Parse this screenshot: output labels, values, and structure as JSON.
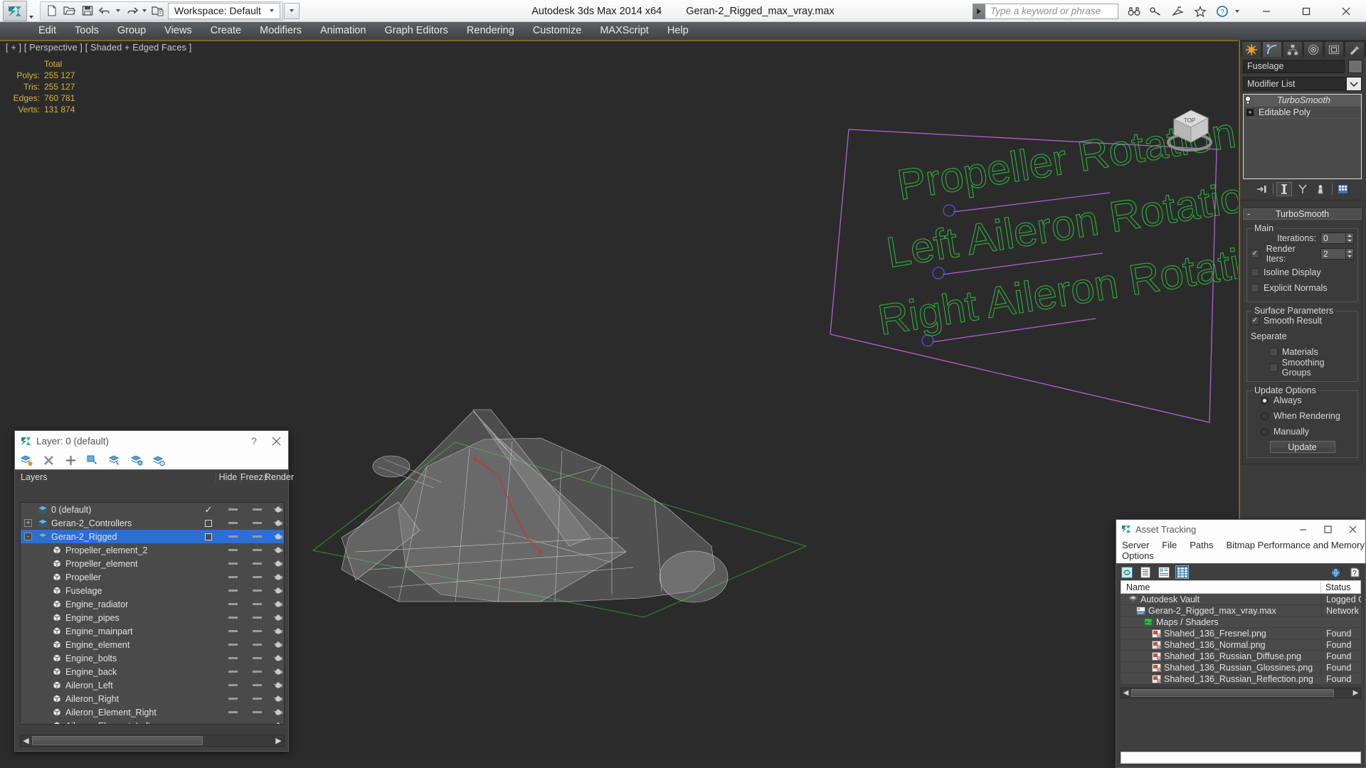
{
  "titlebar": {
    "app_name": "Autodesk 3ds Max  2014 x64",
    "file_name": "Geran-2_Rigged_max_vray.max",
    "workspace_label": "Workspace: Default",
    "search_placeholder": "Type a keyword or phrase",
    "quick_access": [
      "new-icon",
      "open-icon",
      "save-icon",
      "undo-icon",
      "redo-icon",
      "set-project-icon"
    ],
    "window_buttons": [
      "minimize",
      "maximize",
      "close"
    ],
    "help_icons": [
      "binoculars-icon",
      "key-icon",
      "satellite-icon",
      "star-icon",
      "help-icon"
    ]
  },
  "menubar": {
    "items": [
      "Edit",
      "Tools",
      "Group",
      "Views",
      "Create",
      "Modifiers",
      "Animation",
      "Graph Editors",
      "Rendering",
      "Customize",
      "MAXScript",
      "Help"
    ]
  },
  "viewport": {
    "label": "[ + ] [ Perspective ] [ Shaded + Edged Faces ]",
    "stats": {
      "header": "Total",
      "rows": [
        {
          "label": "Polys:",
          "value": "255 127"
        },
        {
          "label": "Tris:",
          "value": "255 127"
        },
        {
          "label": "Edges:",
          "value": "760 781"
        },
        {
          "label": "Verts:",
          "value": "131 874"
        }
      ]
    },
    "annotations": [
      "Propeller Rotation",
      "Left Aileron Rotation",
      "Right Aileron Rotation"
    ],
    "annotation_color": "#2fb03c",
    "helper_color": "#b45fd6",
    "grid_color": "#2f7a34"
  },
  "command_panel": {
    "tabs": [
      "create-tab",
      "modify-tab",
      "hierarchy-tab",
      "motion-tab",
      "display-tab",
      "utilities-tab"
    ],
    "active_tab": "modify-tab",
    "object_name": "Fuselage",
    "modifier_list_label": "Modifier List",
    "stack": [
      {
        "name": "TurboSmooth",
        "selected": true
      },
      {
        "name": "Editable Poly",
        "selected": false
      }
    ],
    "stack_buttons": [
      "pin-stack-icon",
      "show-end-result-icon",
      "make-unique-icon",
      "remove-modifier-icon",
      "configure-sets-icon"
    ],
    "rollout": {
      "title": "TurboSmooth",
      "collapse_glyph": "-",
      "groups": [
        {
          "name": "Main",
          "fields": [
            {
              "label": "Iterations:",
              "value": "0",
              "type": "spinner"
            },
            {
              "label": "Render Iters:",
              "value": "2",
              "type": "spinner",
              "checkbox": true,
              "checked": true
            }
          ],
          "checkboxes": [
            {
              "label": "Isoline Display",
              "checked": false
            },
            {
              "label": "Explicit Normals",
              "checked": false
            }
          ]
        },
        {
          "name": "Surface Parameters",
          "checkboxes": [
            {
              "label": "Smooth Result",
              "checked": true
            }
          ],
          "subgroup_label": "Separate",
          "sub_checkboxes": [
            {
              "label": "Materials",
              "checked": false
            },
            {
              "label": "Smoothing Groups",
              "checked": false
            }
          ]
        },
        {
          "name": "Update Options",
          "radios": [
            {
              "label": "Always",
              "selected": true
            },
            {
              "label": "When Rendering",
              "selected": false
            },
            {
              "label": "Manually",
              "selected": false
            }
          ],
          "button": "Update"
        }
      ]
    }
  },
  "layer_dialog": {
    "title": "Layer: 0 (default)",
    "help_glyph": "?",
    "close_glyph": "✕",
    "toolbar_icons": [
      "create-new-layer-icon",
      "delete-layer-icon",
      "add-selection-icon",
      "select-objects-icon",
      "select-highlighted-icon",
      "highlight-selected-icon",
      "layer-properties-icon"
    ],
    "columns": [
      "Layers",
      "",
      "Hide",
      "Freeze",
      "Render"
    ],
    "rows": [
      {
        "name": "0 (default)",
        "indent": 1,
        "icon": "layer-icon",
        "expander": "",
        "hide": "check",
        "freeze": "dash",
        "render_col": "dash",
        "render": "teapot",
        "selected": false
      },
      {
        "name": "Geran-2_Controllers",
        "indent": 1,
        "icon": "layer-icon",
        "expander": "+",
        "hide": "square",
        "freeze": "dash",
        "render_col": "dash",
        "render": "teapot",
        "selected": false
      },
      {
        "name": "Geran-2_Rigged",
        "indent": 1,
        "icon": "layer-icon",
        "expander": "-",
        "hide": "square",
        "freeze": "dash",
        "render_col": "dash",
        "render": "teapot",
        "selected": true
      },
      {
        "name": "Propeller_element_2",
        "indent": 2,
        "icon": "object-icon",
        "expander": "",
        "hide": "",
        "freeze": "dash",
        "render_col": "dash",
        "render": "teapot",
        "selected": false
      },
      {
        "name": "Propeller_element",
        "indent": 2,
        "icon": "object-icon",
        "expander": "",
        "hide": "",
        "freeze": "dash",
        "render_col": "dash",
        "render": "teapot",
        "selected": false
      },
      {
        "name": "Propeller",
        "indent": 2,
        "icon": "object-icon",
        "expander": "",
        "hide": "",
        "freeze": "dash",
        "render_col": "dash",
        "render": "teapot",
        "selected": false
      },
      {
        "name": "Fuselage",
        "indent": 2,
        "icon": "object-icon",
        "expander": "",
        "hide": "",
        "freeze": "dash",
        "render_col": "dash",
        "render": "teapot",
        "selected": false
      },
      {
        "name": "Engine_radiator",
        "indent": 2,
        "icon": "object-icon",
        "expander": "",
        "hide": "",
        "freeze": "dash",
        "render_col": "dash",
        "render": "teapot",
        "selected": false
      },
      {
        "name": "Engine_pipes",
        "indent": 2,
        "icon": "object-icon",
        "expander": "",
        "hide": "",
        "freeze": "dash",
        "render_col": "dash",
        "render": "teapot",
        "selected": false
      },
      {
        "name": "Engine_mainpart",
        "indent": 2,
        "icon": "object-icon",
        "expander": "",
        "hide": "",
        "freeze": "dash",
        "render_col": "dash",
        "render": "teapot",
        "selected": false
      },
      {
        "name": "Engine_element",
        "indent": 2,
        "icon": "object-icon",
        "expander": "",
        "hide": "",
        "freeze": "dash",
        "render_col": "dash",
        "render": "teapot",
        "selected": false
      },
      {
        "name": "Engine_bolts",
        "indent": 2,
        "icon": "object-icon",
        "expander": "",
        "hide": "",
        "freeze": "dash",
        "render_col": "dash",
        "render": "teapot",
        "selected": false
      },
      {
        "name": "Engine_back",
        "indent": 2,
        "icon": "object-icon",
        "expander": "",
        "hide": "",
        "freeze": "dash",
        "render_col": "dash",
        "render": "teapot",
        "selected": false
      },
      {
        "name": "Aileron_Left",
        "indent": 2,
        "icon": "object-icon",
        "expander": "",
        "hide": "",
        "freeze": "dash",
        "render_col": "dash",
        "render": "teapot",
        "selected": false
      },
      {
        "name": "Aileron_Right",
        "indent": 2,
        "icon": "object-icon",
        "expander": "",
        "hide": "",
        "freeze": "dash",
        "render_col": "dash",
        "render": "teapot",
        "selected": false
      },
      {
        "name": "Aileron_Element_Right",
        "indent": 2,
        "icon": "object-icon",
        "expander": "",
        "hide": "",
        "freeze": "dash",
        "render_col": "dash",
        "render": "teapot",
        "selected": false
      },
      {
        "name": "Aileron_Element_Left",
        "indent": 2,
        "icon": "object-icon",
        "expander": "",
        "hide": "",
        "freeze": "dash",
        "render_col": "dash",
        "render": "teapot",
        "selected": false
      }
    ]
  },
  "asset_tracking": {
    "title": "Asset Tracking",
    "menu": [
      "Server",
      "File",
      "Paths",
      "Bitmap Performance and Memory",
      "Options"
    ],
    "toolbar_icons": [
      "refresh-icon",
      "list-view-icon",
      "details-view-icon",
      "grid-view-icon"
    ],
    "right_icons": [
      "help-web-icon",
      "help-icon"
    ],
    "columns": [
      "Name",
      "Status"
    ],
    "rows": [
      {
        "name": "Autodesk Vault",
        "status": "Logged O",
        "indent": 1,
        "icon": "vault-icon"
      },
      {
        "name": "Geran-2_Rigged_max_vray.max",
        "status": "Network F",
        "indent": 2,
        "icon": "max-file-icon"
      },
      {
        "name": "Maps / Shaders",
        "status": "",
        "indent": 3,
        "icon": "maps-icon"
      },
      {
        "name": "Shahed_136_Fresnel.png",
        "status": "Found",
        "indent": 4,
        "icon": "bitmap-icon"
      },
      {
        "name": "Shahed_136_Normal.png",
        "status": "Found",
        "indent": 4,
        "icon": "bitmap-icon"
      },
      {
        "name": "Shahed_136_Russian_Diffuse.png",
        "status": "Found",
        "indent": 4,
        "icon": "bitmap-icon"
      },
      {
        "name": "Shahed_136_Russian_Glossines.png",
        "status": "Found",
        "indent": 4,
        "icon": "bitmap-icon"
      },
      {
        "name": "Shahed_136_Russian_Reflection.png",
        "status": "Found",
        "indent": 4,
        "icon": "bitmap-icon"
      }
    ]
  }
}
